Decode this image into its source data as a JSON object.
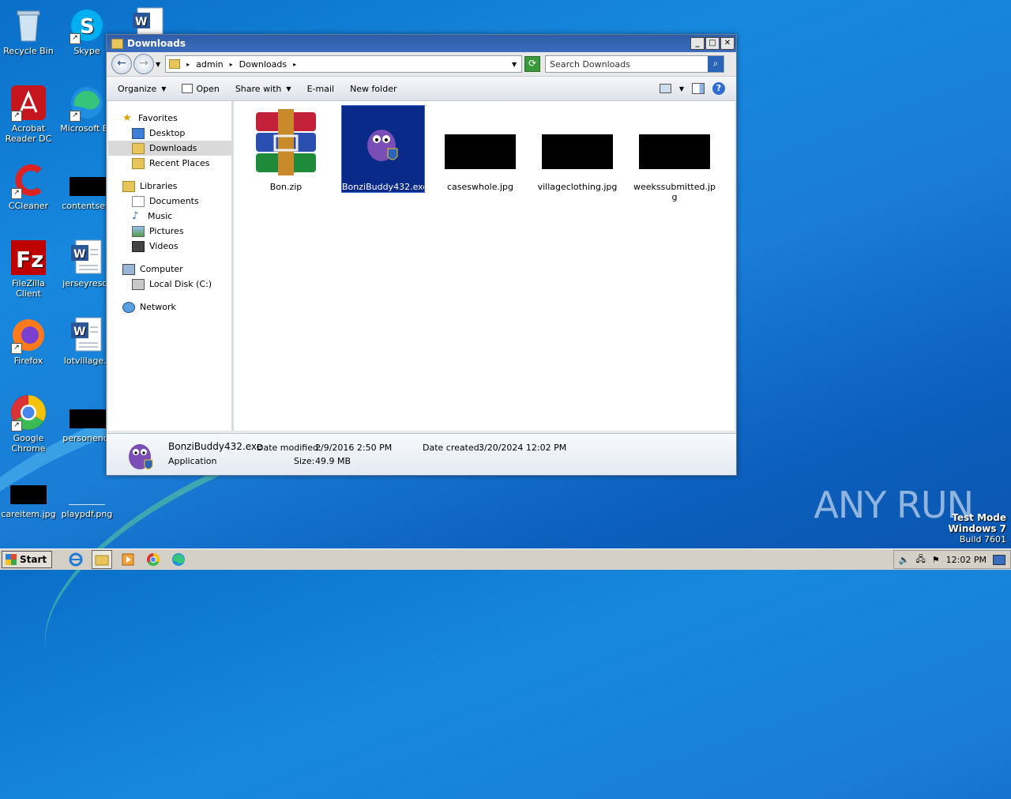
{
  "desktop": {
    "icons": [
      {
        "label": "Recycle Bin",
        "icon": "recycle-bin-icon"
      },
      {
        "label": "Skype",
        "icon": "skype-icon"
      },
      {
        "label": "Acrobat Reader DC",
        "icon": "acrobat-icon"
      },
      {
        "label": "Microsoft Ed",
        "icon": "edge-icon"
      },
      {
        "label": "CCleaner",
        "icon": "ccleaner-icon"
      },
      {
        "label": "contentsett",
        "icon": "black-image-icon"
      },
      {
        "label": "FileZilla Client",
        "icon": "filezilla-icon"
      },
      {
        "label": "jerseyresor",
        "icon": "word-doc-icon"
      },
      {
        "label": "Firefox",
        "icon": "firefox-icon"
      },
      {
        "label": "lotvillage.r",
        "icon": "word-doc-icon"
      },
      {
        "label": "Google Chrome",
        "icon": "chrome-icon"
      },
      {
        "label": "personendi",
        "icon": "black-image-icon"
      },
      {
        "label": "careitem.jpg",
        "icon": "black-image-icon"
      },
      {
        "label": "playpdf.png",
        "icon": "white-image-icon"
      }
    ]
  },
  "window": {
    "title": "Downloads",
    "buttons": {
      "minimize": "_",
      "maximize": "□",
      "close": "✕"
    },
    "breadcrumb": [
      "admin",
      "Downloads"
    ],
    "search_placeholder": "Search Downloads",
    "toolbar": {
      "organize": "Organize",
      "open": "Open",
      "share_with": "Share with",
      "email": "E-mail",
      "new_folder": "New folder"
    },
    "nav": {
      "favorites": "Favorites",
      "desktop": "Desktop",
      "downloads": "Downloads",
      "recent_places": "Recent Places",
      "libraries": "Libraries",
      "documents": "Documents",
      "music": "Music",
      "pictures": "Pictures",
      "videos": "Videos",
      "computer": "Computer",
      "local_disk": "Local Disk (C:)",
      "network": "Network"
    },
    "files": [
      {
        "name": "Bon.zip",
        "type": "winrar-archive"
      },
      {
        "name": "BonziBuddy432.exe",
        "type": "bonzi-exe",
        "selected": true
      },
      {
        "name": "caseswhole.jpg",
        "type": "black-jpg"
      },
      {
        "name": "villageclothing.jpg",
        "type": "black-jpg"
      },
      {
        "name": "weekssubmitted.jpg",
        "type": "black-jpg"
      }
    ],
    "details": {
      "filename": "BonziBuddy432.exe",
      "kind": "Application",
      "modified_label": "Date modified:",
      "modified_value": "2/9/2016 2:50 PM",
      "size_label": "Size:",
      "size_value": "49.9 MB",
      "created_label": "Date created:",
      "created_value": "3/20/2024 12:02 PM"
    }
  },
  "taskbar": {
    "start_label": "Start",
    "clock": "12:02 PM"
  },
  "watermark": {
    "brand": "ANY RUN",
    "mode": "Test Mode",
    "os": "Windows 7",
    "build": "Build 7601"
  }
}
